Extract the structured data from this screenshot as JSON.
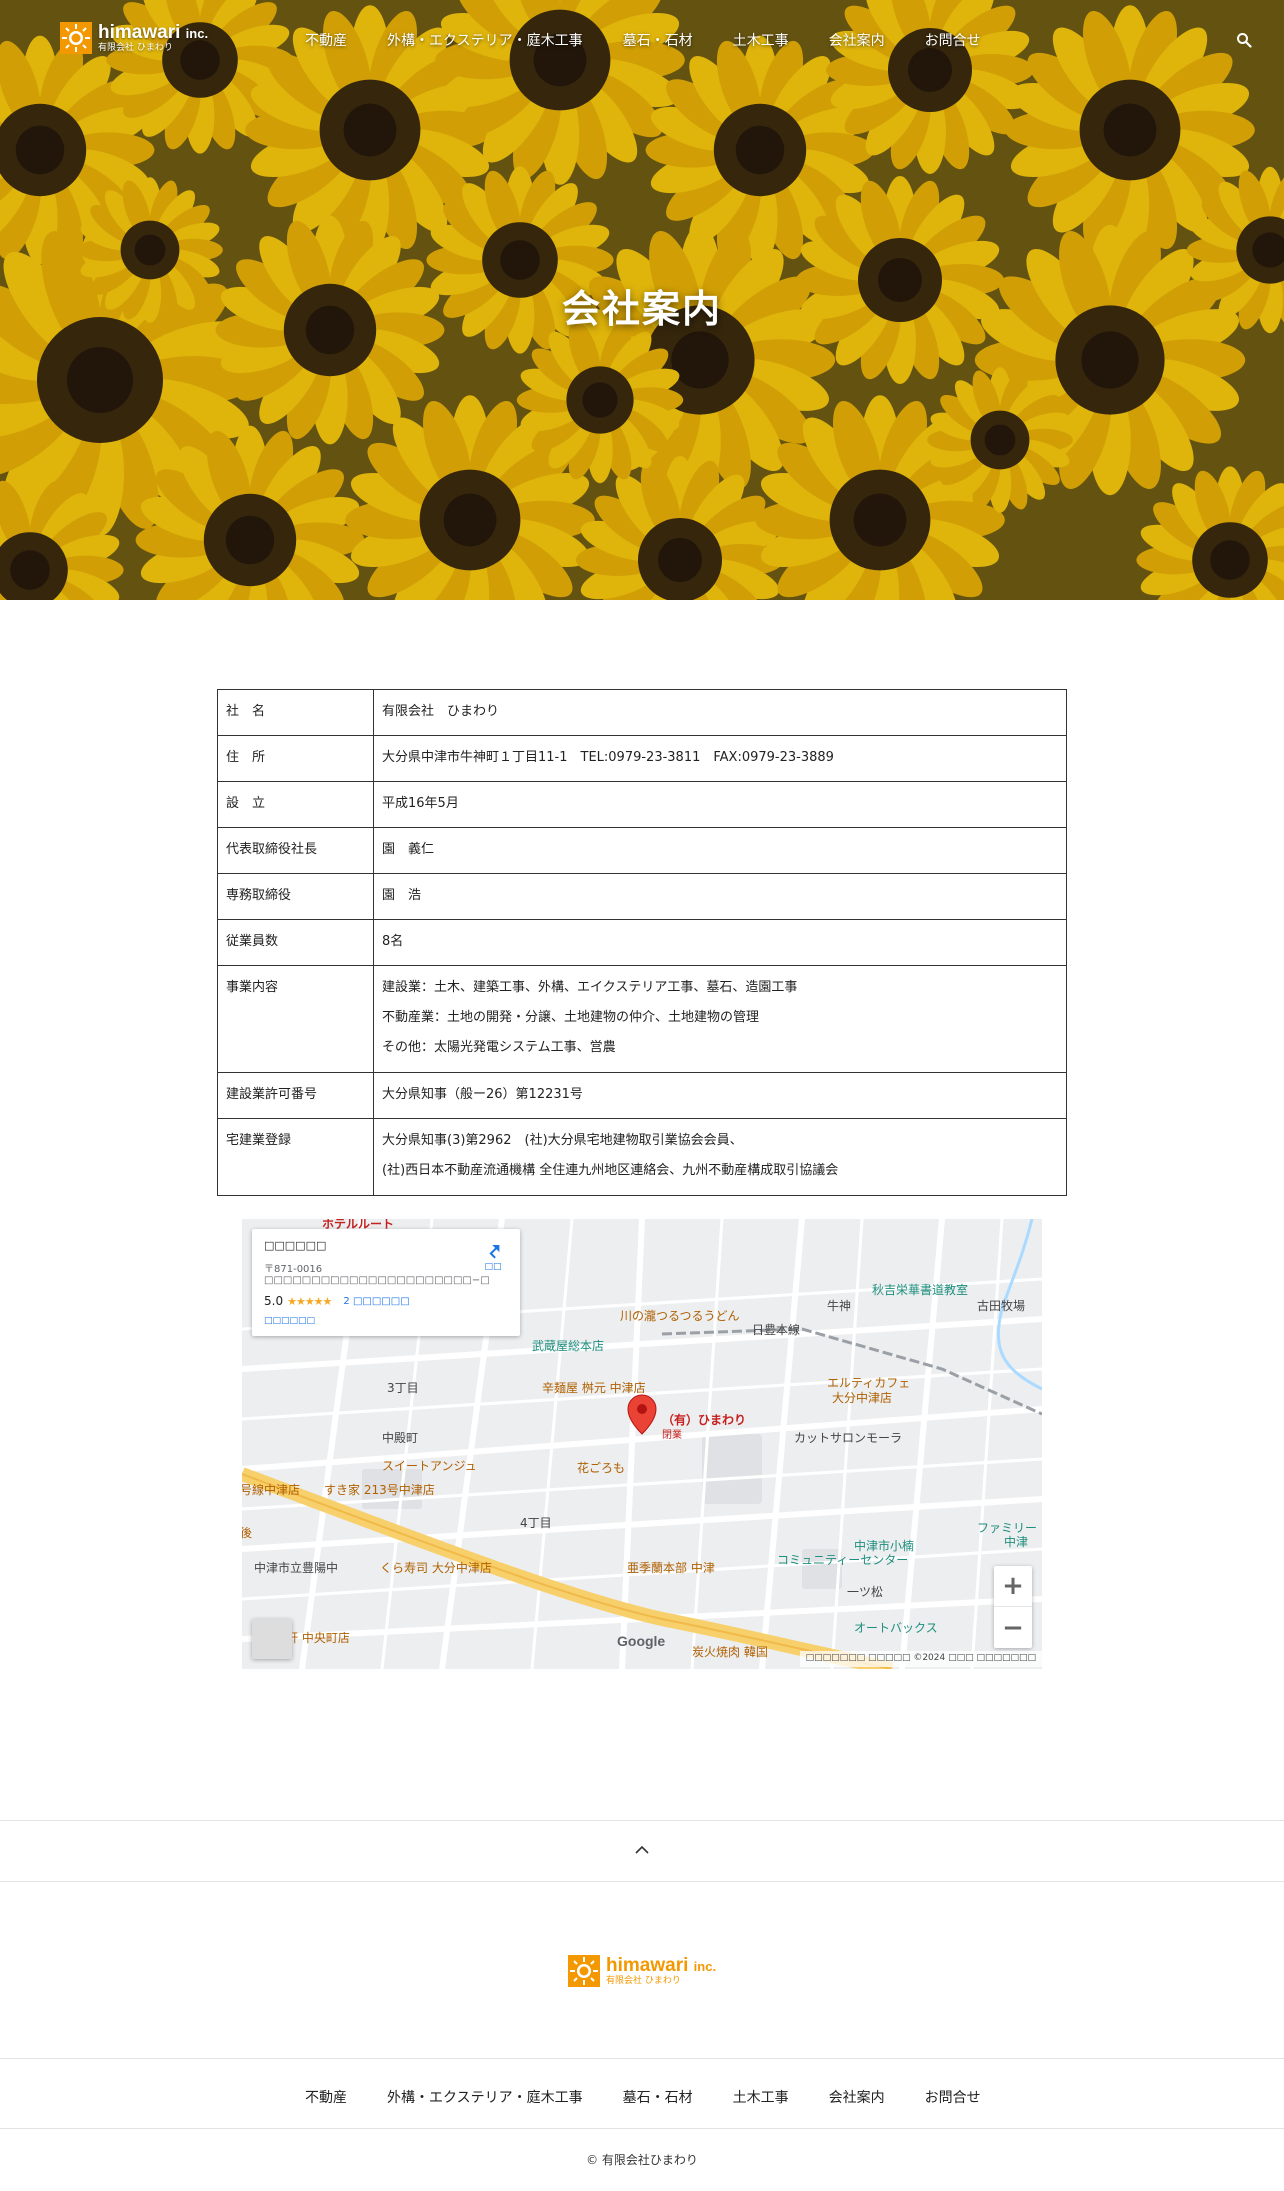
{
  "header": {
    "logo_en": "himawari",
    "logo_en_suffix": "inc.",
    "logo_jp": "有限会社 ひまわり",
    "nav": [
      "不動産",
      "外構・エクステリア・庭木工事",
      "墓石・石材",
      "土木工事",
      "会社案内",
      "お問合せ"
    ]
  },
  "hero": {
    "title": "会社案内"
  },
  "company": {
    "rows": [
      {
        "label": "社　名",
        "lines": [
          "有限会社　ひまわり"
        ]
      },
      {
        "label": "住　所",
        "lines": [
          "大分県中津市牛神町１丁目11-1　TEL:0979-23-3811　FAX:0979-23-3889"
        ]
      },
      {
        "label": "設　立",
        "lines": [
          "平成16年5月"
        ]
      },
      {
        "label": "代表取締役社長",
        "lines": [
          "園　義仁"
        ]
      },
      {
        "label": "専務取締役",
        "lines": [
          "園　浩"
        ]
      },
      {
        "label": "従業員数",
        "lines": [
          "8名"
        ]
      },
      {
        "label": "事業内容",
        "lines": [
          "建設業：土木、建築工事、外構、エイクステリア工事、墓石、造園工事",
          "不動産業：土地の開発・分譲、土地建物の仲介、土地建物の管理",
          "その他：太陽光発電システム工事、営農"
        ]
      },
      {
        "label": "建設業許可番号",
        "lines": [
          "大分県知事（般ー26）第12231号"
        ]
      },
      {
        "label": "宅建業登録",
        "lines": [
          "大分県知事(3)第2962　(社)大分県宅地建物取引業協会会員、",
          "(社)西日本不動産流通機構 全住連九州地区連絡会、九州不動産構成取引協議会"
        ]
      }
    ]
  },
  "map": {
    "card": {
      "address": "〒871-0016",
      "rating": "5.0",
      "stars": "★★★★★",
      "reviews": "2"
    },
    "marker_label": "（有）ひまわり",
    "marker_sub": "閉業",
    "labels": [
      {
        "text": "ホテルルート",
        "cls": "ml-r"
      },
      {
        "text": "秋吉栄華書道教室",
        "cls": "ml-t"
      },
      {
        "text": "古田牧場",
        "cls": "ml-g"
      },
      {
        "text": "川の瀧つるつるうどん",
        "cls": "ml-o"
      },
      {
        "text": "牛神",
        "cls": "ml-g"
      },
      {
        "text": "日豊本線",
        "cls": "ml-g"
      },
      {
        "text": "武蔵屋総本店",
        "cls": "ml-t"
      },
      {
        "text": "3丁目",
        "cls": "ml-g"
      },
      {
        "text": "辛麺屋 桝元 中津店",
        "cls": "ml-o"
      },
      {
        "text": "エルティカフェ",
        "cls": "ml-o"
      },
      {
        "text": "大分中津店",
        "cls": "ml-o"
      },
      {
        "text": "カットサロンモーラ",
        "cls": "ml-g"
      },
      {
        "text": "中殿町",
        "cls": "ml-g"
      },
      {
        "text": "スイートアンジュ",
        "cls": "ml-o"
      },
      {
        "text": "花ごろも",
        "cls": "ml-o"
      },
      {
        "text": "号線中津店",
        "cls": "ml-o"
      },
      {
        "text": "すき家 213号中津店",
        "cls": "ml-o"
      },
      {
        "text": "4丁目",
        "cls": "ml-g"
      },
      {
        "text": "ファミリー",
        "cls": "ml-t"
      },
      {
        "text": "中津",
        "cls": "ml-t"
      },
      {
        "text": "中津市立豊陽中",
        "cls": "ml-g"
      },
      {
        "text": "くら寿司 大分中津店",
        "cls": "ml-o"
      },
      {
        "text": "亜季蘭本部 中津",
        "cls": "ml-o"
      },
      {
        "text": "中津市小楠",
        "cls": "ml-t"
      },
      {
        "text": "コミュニティーセンター",
        "cls": "ml-t"
      },
      {
        "text": "一ツ松",
        "cls": "ml-g"
      },
      {
        "text": "来軒 中央町店",
        "cls": "ml-o"
      },
      {
        "text": "オートバックス",
        "cls": "ml-t"
      },
      {
        "text": "炭火焼肉 韓国",
        "cls": "ml-o"
      },
      {
        "text": "後",
        "cls": "ml-o"
      }
    ],
    "google": "Google",
    "attribution": "©2024"
  },
  "footer": {
    "logo_en": "himawari",
    "logo_en_suffix": "inc.",
    "logo_jp": "有限会社 ひまわり",
    "nav": [
      "不動産",
      "外構・エクステリア・庭木工事",
      "墓石・石材",
      "土木工事",
      "会社案内",
      "お問合せ"
    ],
    "copyright": "© 有限会社ひまわり"
  },
  "colors": {
    "accent": "#f39800",
    "marker": "#ea4335",
    "road": "#ffffff",
    "highway": "#f7d06b"
  }
}
